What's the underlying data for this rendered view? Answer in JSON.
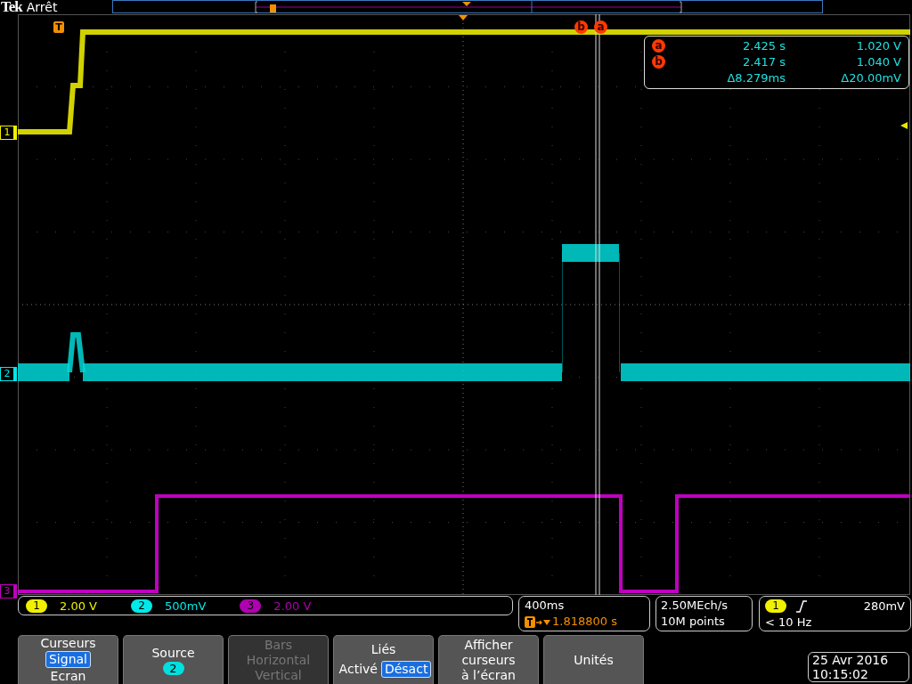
{
  "header": {
    "brand": "Tek",
    "state": "Arrêt"
  },
  "trigger_marker": "T",
  "cursor_markers": [
    {
      "label": "b"
    },
    {
      "label": "a"
    }
  ],
  "channel_markers": [
    {
      "label": "1",
      "color": "#f0f000"
    },
    {
      "label": "2",
      "color": "#00e8e8"
    },
    {
      "label": "3",
      "color": "#c000c0"
    }
  ],
  "cursor_readout": {
    "rows": [
      {
        "label": "a",
        "time": "2.425 s",
        "value": "1.020 V"
      },
      {
        "label": "b",
        "time": "2.417 s",
        "value": "1.040 V"
      }
    ],
    "delta_time": "Δ8.279ms",
    "delta_value": "Δ20.00mV"
  },
  "channels": [
    {
      "number": "1",
      "scale": "2.00 V",
      "color": "#f0f000"
    },
    {
      "number": "2",
      "scale": "500mV",
      "color": "#00e8e8"
    },
    {
      "number": "3",
      "scale": "2.00 V",
      "color": "#b000b0"
    }
  ],
  "timebase": {
    "scale": "400ms",
    "position": "1.818800 s"
  },
  "acquisition": {
    "rate": "2.50MEch/s",
    "record": "10M points"
  },
  "trigger": {
    "source": "1",
    "level": "280mV",
    "frequency": "< 10 Hz"
  },
  "menu": [
    {
      "kind": "options",
      "title": "Curseurs",
      "disabled": false,
      "options": [
        {
          "label": "Signal",
          "selected": true
        },
        {
          "label": "Ecran",
          "selected": false
        }
      ]
    },
    {
      "kind": "badge",
      "title": "Source",
      "disabled": false,
      "badge": "2"
    },
    {
      "kind": "lines",
      "disabled": true,
      "lines": [
        "Bars",
        "Horizontal",
        "Vertical"
      ]
    },
    {
      "kind": "toggle",
      "title": "Liés",
      "disabled": false,
      "options": [
        {
          "label": "Activé",
          "selected": false
        },
        {
          "label": "Désact",
          "selected": true
        }
      ]
    },
    {
      "kind": "lines",
      "disabled": false,
      "lines": [
        "Afficher",
        "curseurs",
        "à l’écran"
      ]
    },
    {
      "kind": "lines",
      "disabled": false,
      "lines": [
        "Unités"
      ]
    }
  ],
  "datetime": {
    "date": "25 Avr  2016",
    "time": "10:15:02"
  }
}
